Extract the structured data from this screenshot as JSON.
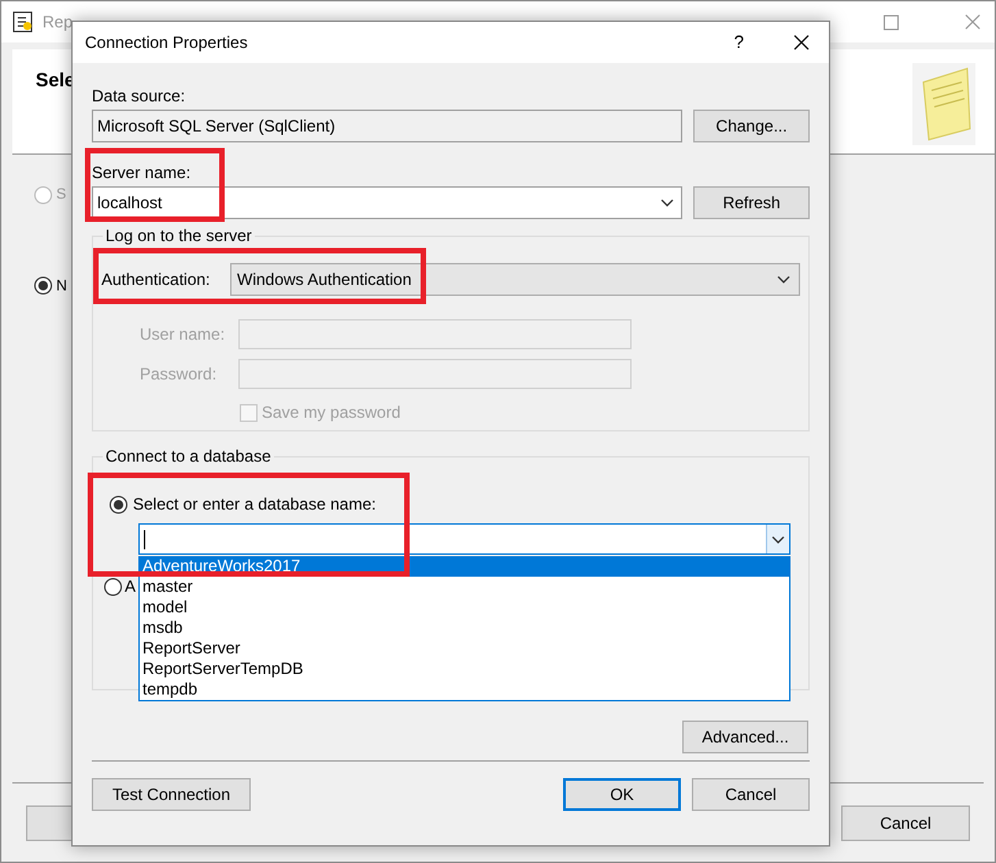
{
  "background_window": {
    "title": "Rep",
    "header_title": "Sele",
    "options": [
      {
        "label": "S",
        "selected": false,
        "disabled": true
      },
      {
        "label": "N",
        "selected": true,
        "disabled": false
      }
    ],
    "buttons": [
      "Cancel"
    ]
  },
  "dialog": {
    "title": "Connection Properties",
    "help": "?",
    "data_source": {
      "label": "Data source:",
      "value": "Microsoft SQL Server (SqlClient)",
      "button": "Change..."
    },
    "server": {
      "label": "Server name:",
      "value": "localhost",
      "button": "Refresh"
    },
    "logon": {
      "title": "Log on to the server",
      "authentication": {
        "label": "Authentication:",
        "value": "Windows Authentication"
      },
      "fields": [
        {
          "label": "User name:",
          "disabled": true
        },
        {
          "label": "Password:",
          "disabled": true
        }
      ],
      "save_password": {
        "label": "Save my password",
        "checked": false,
        "disabled": true
      }
    },
    "database": {
      "title": "Connect to a database",
      "options": [
        {
          "label": "Select or enter a database name:",
          "selected": true
        },
        {
          "label": "A",
          "selected": false
        }
      ],
      "items": [
        {
          "label": "AdventureWorks2017",
          "selected": true
        },
        {
          "label": "master",
          "selected": false
        },
        {
          "label": "model",
          "selected": false
        },
        {
          "label": "msdb",
          "selected": false
        },
        {
          "label": "ReportServer",
          "selected": false
        },
        {
          "label": "ReportServerTempDB",
          "selected": false
        },
        {
          "label": "tempdb",
          "selected": false
        }
      ]
    },
    "advanced": {
      "label": "Advanced...",
      "default": false
    },
    "buttons": [
      {
        "label": "Test Connection",
        "default": false
      },
      {
        "label": "OK",
        "default": true
      },
      {
        "label": "Cancel",
        "default": false
      }
    ]
  }
}
